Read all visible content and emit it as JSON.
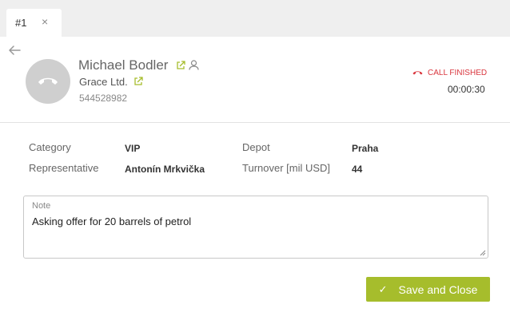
{
  "tab": {
    "label": "#1",
    "close": "×"
  },
  "contact": {
    "name": "Michael Bodler",
    "company": "Grace Ltd.",
    "phone": "544528982"
  },
  "call": {
    "status": "CALL FINISHED",
    "duration": "00:00:30",
    "status_color": "#d9363e"
  },
  "details": {
    "category_label": "Category",
    "category_value": "VIP",
    "depot_label": "Depot",
    "depot_value": "Praha",
    "representative_label": "Representative",
    "representative_value": "Antonín Mrkvička",
    "turnover_label": "Turnover [mil USD]",
    "turnover_value": "44"
  },
  "note": {
    "label": "Note",
    "text": "Asking offer for 20 barrels of petrol"
  },
  "actions": {
    "save_label": "Save and Close",
    "save_color": "#a6bd2c"
  },
  "icons": {
    "back": "arrow-left-icon",
    "avatar": "phone-hangup-icon",
    "external_link": "external-link-icon",
    "person": "person-icon",
    "status": "phone-hangup-icon",
    "check": "check-icon"
  },
  "colors": {
    "accent": "#a6bd2c",
    "tabbar_bg": "#efefef",
    "avatar_bg": "#cfcfcf"
  }
}
